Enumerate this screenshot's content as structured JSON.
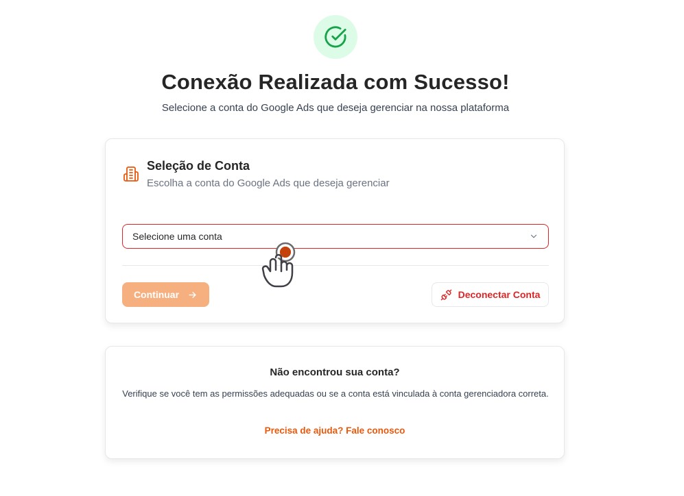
{
  "header": {
    "title": "Conexão Realizada com Sucesso!",
    "subtitle": "Selecione a conta do Google Ads que deseja gerenciar na nossa plataforma",
    "status_icon": "check-circle-icon",
    "status_color": "#16a34a"
  },
  "account_card": {
    "title": "Seleção de Conta",
    "description": "Escolha a conta do Google Ads que deseja gerenciar",
    "icon": "building-icon",
    "select": {
      "value": "Selecione uma conta",
      "icon": "chevron-down-icon"
    },
    "continue_label": "Continuar",
    "disconnect_label": "Deconectar Conta"
  },
  "help_card": {
    "title": "Não encontrou sua conta?",
    "text": "Verifique se você tem as permissões adequadas ou se a conta está vinculada à conta gerenciadora correta.",
    "link_label": "Precisa de ajuda? Fale conosco"
  },
  "colors": {
    "accent": "#ea580c",
    "continue_disabled": "#f6b07f",
    "danger": "#dc2626",
    "success_bg": "#dcfce7"
  }
}
